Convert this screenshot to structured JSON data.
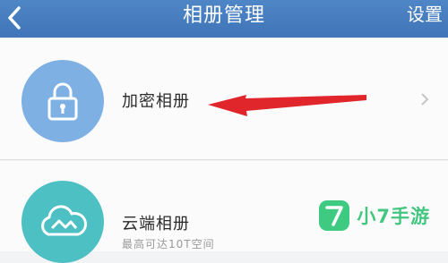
{
  "navbar": {
    "title": "相册管理",
    "settings_label": "设置",
    "back_icon": "chevron-left-icon"
  },
  "albums": [
    {
      "label": "加密相册",
      "icon": "lock-icon",
      "icon_color": "#7eb0e4"
    },
    {
      "label": "云端相册",
      "subtitle": "最高可达10T空间",
      "icon": "cloud-icon",
      "icon_color": "#4dc0c4"
    }
  ],
  "annotation": {
    "color": "#e0252b"
  },
  "watermark": {
    "logo_glyph": "7",
    "text": "小7手游",
    "color": "#43c680"
  }
}
